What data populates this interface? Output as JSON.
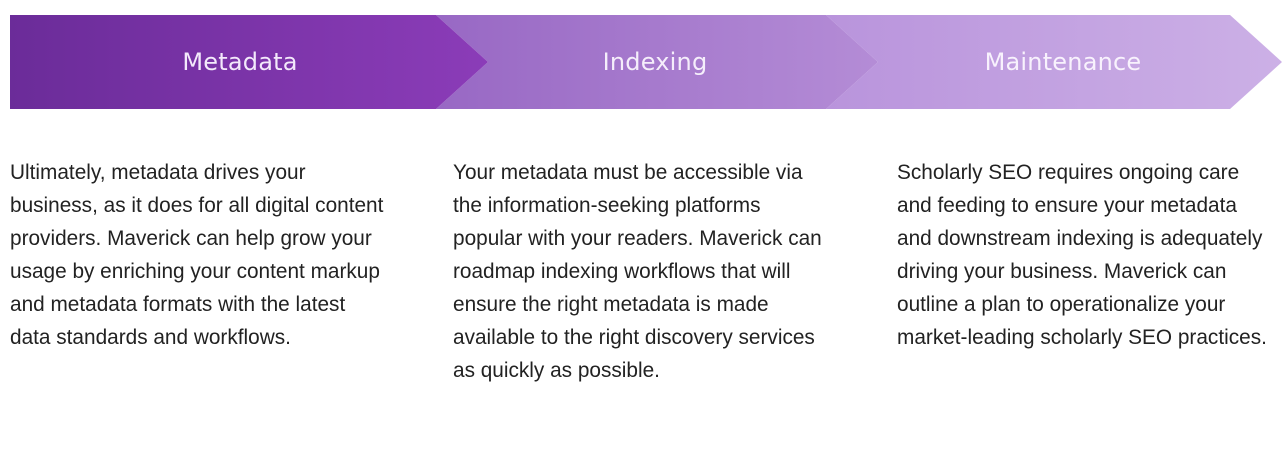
{
  "stages": [
    {
      "title": "Metadata",
      "description": "Ultimately, metadata drives your business, as it does for all digital content providers. Maverick can help grow your usage by enriching your content markup and metadata formats with the latest data standards and workflows.",
      "color_light": "#8b3cb8",
      "color_dark": "#6b2c99",
      "text_color": "#f3e9fb"
    },
    {
      "title": "Indexing",
      "description": "Your metadata must be accessible via the information-seeking platforms popular with your readers. Maverick can roadmap indexing workflows that will ensure the right metadata is made available to the right discovery services as quickly as possible.",
      "color_light": "#b48cd6",
      "color_dark": "#9868c4",
      "text_color": "#f5eefb"
    },
    {
      "title": "Maintenance",
      "description": "Scholarly SEO requires ongoing care and feeding to ensure your metadata and downstream indexing is adequately driving your business. Maverick can outline a plan to operationalize your market-leading scholarly SEO practices.",
      "color_light": "#ccb0e6",
      "color_dark": "#b994dc",
      "text_color": "#f8f2fd"
    }
  ]
}
